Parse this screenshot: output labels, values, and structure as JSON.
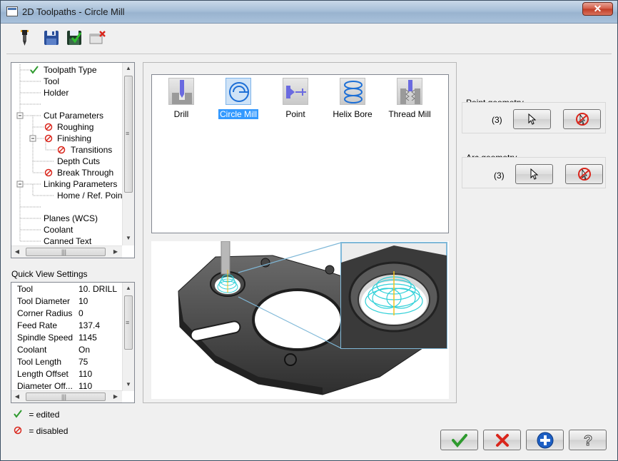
{
  "window": {
    "title": "2D Toolpaths - Circle Mill",
    "close_glyph": "✕"
  },
  "toolbar": {
    "icons": [
      "tool-torch-icon",
      "save-icon",
      "save-as-icon",
      "delete-icon"
    ]
  },
  "tree": {
    "items": [
      {
        "label": "Toolpath Type",
        "state": "edited"
      },
      {
        "label": "Tool",
        "state": "none"
      },
      {
        "label": "Holder",
        "state": "none"
      },
      {
        "label": "",
        "state": "none"
      },
      {
        "label": "Cut Parameters",
        "state": "none"
      },
      {
        "label": "Roughing",
        "state": "disabled"
      },
      {
        "label": "Finishing",
        "state": "disabled"
      },
      {
        "label": "Transitions",
        "state": "disabled"
      },
      {
        "label": "Depth Cuts",
        "state": "none"
      },
      {
        "label": "Break Through",
        "state": "disabled"
      },
      {
        "label": "Linking Parameters",
        "state": "none"
      },
      {
        "label": "Home / Ref. Points",
        "state": "none"
      },
      {
        "label": "",
        "state": "none"
      },
      {
        "label": "Planes (WCS)",
        "state": "none"
      },
      {
        "label": "Coolant",
        "state": "none"
      },
      {
        "label": "Canned Text",
        "state": "none"
      }
    ]
  },
  "quick_view": {
    "label": "Quick View Settings",
    "rows": [
      {
        "key": "Tool",
        "value": "10. DRILL"
      },
      {
        "key": "Tool Diameter",
        "value": "10"
      },
      {
        "key": "Corner Radius",
        "value": "0"
      },
      {
        "key": "Feed Rate",
        "value": "137.4"
      },
      {
        "key": "Spindle Speed",
        "value": "1145"
      },
      {
        "key": "Coolant",
        "value": "On"
      },
      {
        "key": "Tool Length",
        "value": "75"
      },
      {
        "key": "Length Offset",
        "value": "110"
      },
      {
        "key": "Diameter Off...",
        "value": "110"
      }
    ]
  },
  "legend": {
    "edited": "= edited",
    "disabled": "= disabled"
  },
  "toolpath_types": {
    "selected": "Circle Mill",
    "items": [
      {
        "label": "Drill",
        "icon": "drill-icon"
      },
      {
        "label": "Circle Mill",
        "icon": "circle-mill-icon"
      },
      {
        "label": "Point",
        "icon": "point-icon"
      },
      {
        "label": "Helix Bore",
        "icon": "helix-bore-icon"
      },
      {
        "label": "Thread Mill",
        "icon": "thread-mill-icon"
      }
    ]
  },
  "point_geometry": {
    "title": "Point geometry",
    "count": "(3)"
  },
  "arc_geometry": {
    "title": "Arc geometry",
    "count": "(3)"
  },
  "colors": {
    "accent_green": "#2e9a2e",
    "cancel_red": "#d9261c",
    "add_blue": "#1d5fc4",
    "selection": "#3399ff",
    "toolpath_cyan": "#2fd0d8"
  },
  "buttons": [
    "ok-button",
    "cancel-button",
    "add-button",
    "help-button"
  ]
}
